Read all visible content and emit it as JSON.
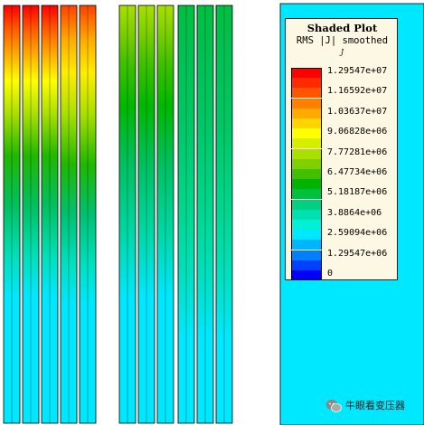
{
  "legend": {
    "title": "Shaded Plot",
    "subtitle": "RMS |J| smoothed",
    "unit": "J",
    "bands": [
      {
        "label": "1.29547e+07",
        "color": "#ff0000"
      },
      {
        "color": "#ff2a00"
      },
      {
        "label": "1.16592e+07",
        "color": "#ff5500"
      },
      {
        "color": "#ff8000"
      },
      {
        "label": "1.03637e+07",
        "color": "#ffaa00"
      },
      {
        "color": "#ffd400"
      },
      {
        "label": "9.06828e+06",
        "color": "#ffff00"
      },
      {
        "color": "#d4f000"
      },
      {
        "label": "7.77281e+06",
        "color": "#aae000"
      },
      {
        "color": "#80d000"
      },
      {
        "label": "6.47734e+06",
        "color": "#40c000"
      },
      {
        "color": "#00b400"
      },
      {
        "label": "5.18187e+06",
        "color": "#00c040"
      },
      {
        "color": "#00d080"
      },
      {
        "label": "3.8864e+06",
        "color": "#00e0b0"
      },
      {
        "color": "#00f0d8"
      },
      {
        "label": "2.59094e+06",
        "color": "#00e8ff"
      },
      {
        "color": "#00b4ff"
      },
      {
        "label": "1.29547e+06",
        "color": "#0080ff"
      },
      {
        "color": "#0040ff"
      },
      {
        "label": "0",
        "color": "#0000ff"
      }
    ]
  },
  "watermark": {
    "text": "牛眼看变压器",
    "icon": "wechat-icon"
  },
  "colors": {
    "background": "#ffffff",
    "core_region": "#00e8ff",
    "legend_bg": "#fdf8e4"
  }
}
